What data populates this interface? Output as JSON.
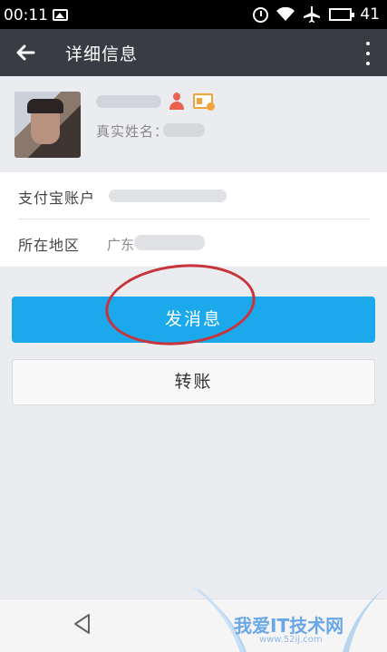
{
  "status_bar": {
    "time": "00:11",
    "battery_level": "41",
    "icons": [
      "image-icon",
      "alarm-icon",
      "wifi-icon",
      "airplane-icon",
      "battery-icon"
    ]
  },
  "appbar": {
    "back_icon": "arrow-left-icon",
    "title": "详细信息",
    "more_icon": "more-vertical-icon"
  },
  "profile": {
    "real_name_label": "真实姓名：",
    "icons": [
      "person-icon",
      "id-card-icon"
    ]
  },
  "info": {
    "alipay_label": "支付宝账户",
    "region_label": "所在地区",
    "region_value": "广东"
  },
  "actions": {
    "send_message": "发消息",
    "transfer": "转账"
  },
  "navbar": {
    "back_icon": "nav-back-triangle-icon"
  },
  "watermark": {
    "text": "我爱IT技术网",
    "url": "www.52ij.com"
  },
  "colors": {
    "appbar_bg": "#393c42",
    "primary_button": "#1ba9ec",
    "annotation_circle": "#c8343c",
    "page_bg": "#ebecf0"
  }
}
